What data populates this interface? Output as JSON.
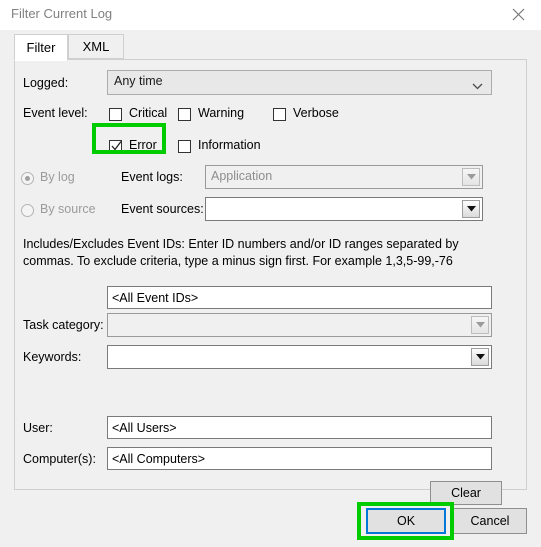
{
  "window": {
    "title": "Filter Current Log",
    "close_icon": "close-icon"
  },
  "tabs": [
    {
      "label": "Filter",
      "active": true
    },
    {
      "label": "XML",
      "active": false
    }
  ],
  "form": {
    "logged": {
      "label": "Logged:",
      "value": "Any time",
      "chevron_icon": "chevron-down-icon"
    },
    "event_level": {
      "label": "Event level:",
      "checkboxes": [
        {
          "label": "Critical",
          "checked": false
        },
        {
          "label": "Warning",
          "checked": false
        },
        {
          "label": "Verbose",
          "checked": false
        },
        {
          "label": "Error",
          "checked": true
        },
        {
          "label": "Information",
          "checked": false
        }
      ]
    },
    "source_mode": {
      "by_log": {
        "label": "By log",
        "selected": true,
        "disabled": true
      },
      "by_source": {
        "label": "By source",
        "selected": false,
        "disabled": true
      }
    },
    "event_logs": {
      "label": "Event logs:",
      "value": "Application",
      "disabled": true,
      "dropdown_icon": "caret-down-icon"
    },
    "event_sources": {
      "label": "Event sources:",
      "value": "",
      "disabled": false,
      "dropdown_icon": "caret-down-icon"
    },
    "help_text": "Includes/Excludes Event IDs: Enter ID numbers and/or ID ranges separated by commas. To exclude criteria, type a minus sign first. For example 1,3,5-99,-76",
    "event_ids": {
      "value": "<All Event IDs>"
    },
    "task_category": {
      "label": "Task category:",
      "value": "",
      "disabled": true,
      "dropdown_icon": "caret-down-icon"
    },
    "keywords": {
      "label": "Keywords:",
      "value": "",
      "disabled": false,
      "dropdown_icon": "caret-down-icon"
    },
    "user": {
      "label": "User:",
      "value": "<All Users>"
    },
    "computers": {
      "label": "Computer(s):",
      "value": "<All Computers>"
    },
    "clear_button": "Clear"
  },
  "footer": {
    "ok_button": "OK",
    "cancel_button": "Cancel"
  },
  "annotations": {
    "highlight_color": "#00cc00",
    "focus_color": "#0078d7",
    "targets": [
      "error-checkbox",
      "ok-button"
    ]
  }
}
